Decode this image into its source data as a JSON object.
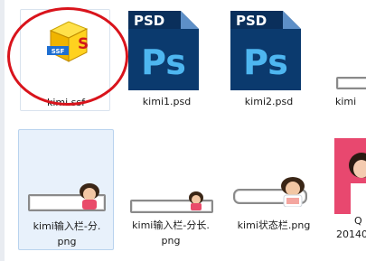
{
  "files": [
    {
      "name": "kimi.ssf",
      "type": "ssf"
    },
    {
      "name": "kimi1.psd",
      "type": "psd"
    },
    {
      "name": "kimi2.psd",
      "type": "psd"
    },
    {
      "name": "kimi",
      "type": "png-partial"
    },
    {
      "name_line1": "kimi输入栏-分.",
      "name_line2": "png",
      "type": "png"
    },
    {
      "name_line1": "kimi输入栏-分长.",
      "name_line2": "png",
      "type": "png"
    },
    {
      "name_line1": "kimi状态栏.png",
      "name_line2": "",
      "type": "png"
    },
    {
      "name_line1": "Q",
      "name_line2": "20140",
      "type": "png-partial"
    }
  ],
  "psd_badge": "PSD",
  "ps_mark": "Ps",
  "ssf_badge": "SSF",
  "colors": {
    "annotation_circle": "#d9141c",
    "psd_blue": "#0b3a6e",
    "ps_text": "#4eb6f0"
  }
}
